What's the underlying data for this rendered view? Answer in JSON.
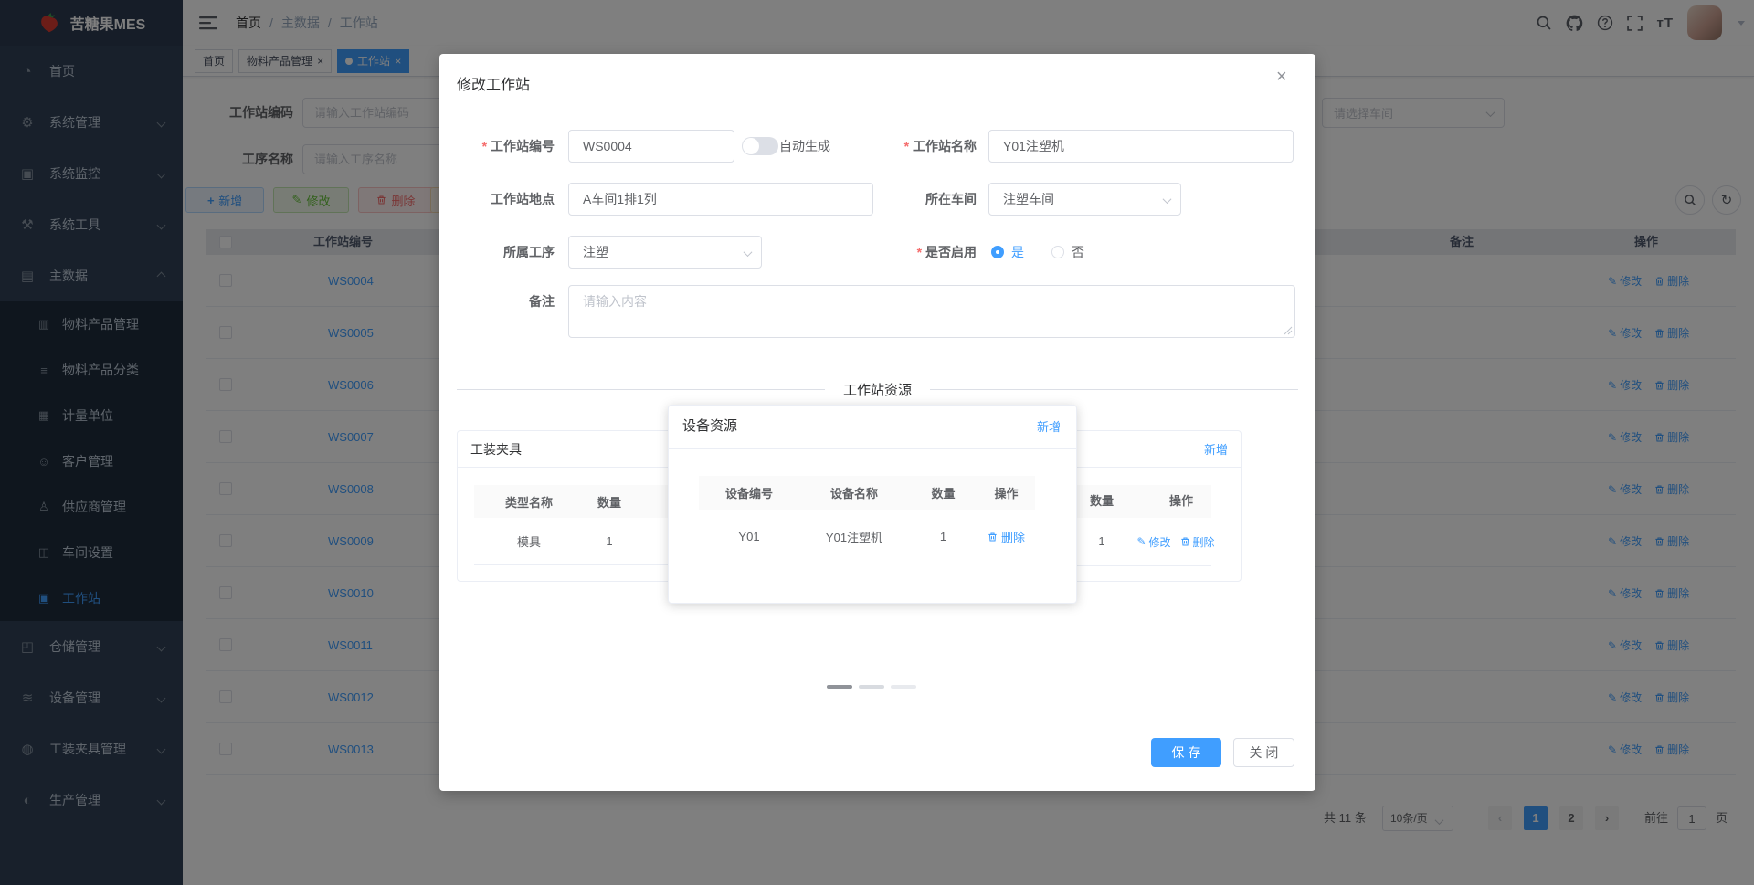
{
  "app": {
    "logo_title": "苦糖果MES"
  },
  "header": {
    "breadcrumb": [
      "首页",
      "主数据",
      "工作站"
    ],
    "separator": "/",
    "icons": [
      "hamburger-icon",
      "search-icon",
      "github-icon",
      "question-icon",
      "fullscreen-icon",
      "font-size-icon",
      "avatar",
      "caret-down-icon"
    ],
    "font_size_icon_text": "тT"
  },
  "tags": {
    "close_glyph": "×",
    "items": [
      {
        "label": "首页",
        "closable": false,
        "active": false
      },
      {
        "label": "物料产品管理",
        "closable": true,
        "active": false
      },
      {
        "label": "工作站",
        "closable": true,
        "active": true
      }
    ]
  },
  "sidebar": {
    "items": [
      {
        "label": "首页",
        "icon": "dashboard-icon",
        "kind": "top"
      },
      {
        "label": "系统管理",
        "icon": "gear-icon",
        "kind": "top",
        "chevron": "down"
      },
      {
        "label": "系统监控",
        "icon": "monitor-icon",
        "kind": "top",
        "chevron": "down"
      },
      {
        "label": "系统工具",
        "icon": "toolbox-icon",
        "kind": "top",
        "chevron": "down"
      },
      {
        "label": "主数据",
        "icon": "database-icon",
        "kind": "top",
        "chevron": "up"
      },
      {
        "label": "物料产品管理",
        "icon": "material-icon",
        "kind": "sub"
      },
      {
        "label": "物料产品分类",
        "icon": "category-icon",
        "kind": "sub"
      },
      {
        "label": "计量单位",
        "icon": "unit-icon",
        "kind": "sub"
      },
      {
        "label": "客户管理",
        "icon": "customer-icon",
        "kind": "sub"
      },
      {
        "label": "供应商管理",
        "icon": "supplier-icon",
        "kind": "sub"
      },
      {
        "label": "车间设置",
        "icon": "workshop-icon",
        "kind": "sub"
      },
      {
        "label": "工作站",
        "icon": "workstation-icon",
        "kind": "sub",
        "active": true
      },
      {
        "label": "仓储管理",
        "icon": "warehouse-icon",
        "kind": "top",
        "chevron": "down"
      },
      {
        "label": "设备管理",
        "icon": "equipment-icon",
        "kind": "top",
        "chevron": "down"
      },
      {
        "label": "工装夹具管理",
        "icon": "fixture-icon",
        "kind": "top",
        "chevron": "down"
      },
      {
        "label": "生产管理",
        "icon": "production-icon",
        "kind": "top",
        "chevron": "down"
      }
    ]
  },
  "filters": {
    "code_label": "工作站编码",
    "code_placeholder": "请输入工作站编码",
    "process_label": "工序名称",
    "process_placeholder": "请输入工序名称",
    "workshop_placeholder": "请选择车间"
  },
  "toolbar": {
    "add": "新增",
    "edit": "修改",
    "delete": "删除"
  },
  "table": {
    "col_code": "工作站编号",
    "col_remark": "备注",
    "col_action": "操作",
    "row_edit": "修改",
    "row_delete": "删除",
    "rows": [
      "WS0004",
      "WS0005",
      "WS0006",
      "WS0007",
      "WS0008",
      "WS0009",
      "WS0010",
      "WS0011",
      "WS0012",
      "WS0013"
    ]
  },
  "pagination": {
    "total": "共 11 条",
    "page_size": "10条/页",
    "prev": "‹",
    "next": "›",
    "pages": [
      "1",
      "2"
    ],
    "active_page": "1",
    "goto_label": "前往",
    "goto_value": "1",
    "goto_unit": "页"
  },
  "modal": {
    "title": "修改工作站",
    "close_glyph": "×",
    "code_label": "工作站编号",
    "code_value": "WS0004",
    "auto_generate_label": "自动生成",
    "name_label": "工作站名称",
    "name_value": "Y01注塑机",
    "location_label": "工作站地点",
    "location_value": "A车间1排1列",
    "workshop_label": "所在车间",
    "workshop_value": "注塑车间",
    "process_label": "所属工序",
    "process_value": "注塑",
    "enabled_label": "是否启用",
    "enabled_yes": "是",
    "enabled_no": "否",
    "remark_label": "备注",
    "remark_placeholder": "请输入内容",
    "divider": "工作站资源",
    "fixture_panel": {
      "title": "工装夹具",
      "col_type": "类型名称",
      "col_qty": "数量",
      "col_action": "操作",
      "row_type": "模具",
      "row_qty": "1",
      "edit": "修改"
    },
    "device_panel": {
      "title": "设备资源",
      "add": "新增",
      "col_code": "设备编号",
      "col_name": "设备名称",
      "col_qty": "数量",
      "col_action": "操作",
      "row_code": "Y01",
      "row_name": "Y01注塑机",
      "row_qty": "1",
      "delete": "删除"
    },
    "right_panel": {
      "add": "新增",
      "col_qty": "数量",
      "col_action": "操作",
      "row_qty": "1",
      "edit": "修改",
      "delete": "删除"
    },
    "save": "保 存",
    "close_btn": "关 闭"
  }
}
